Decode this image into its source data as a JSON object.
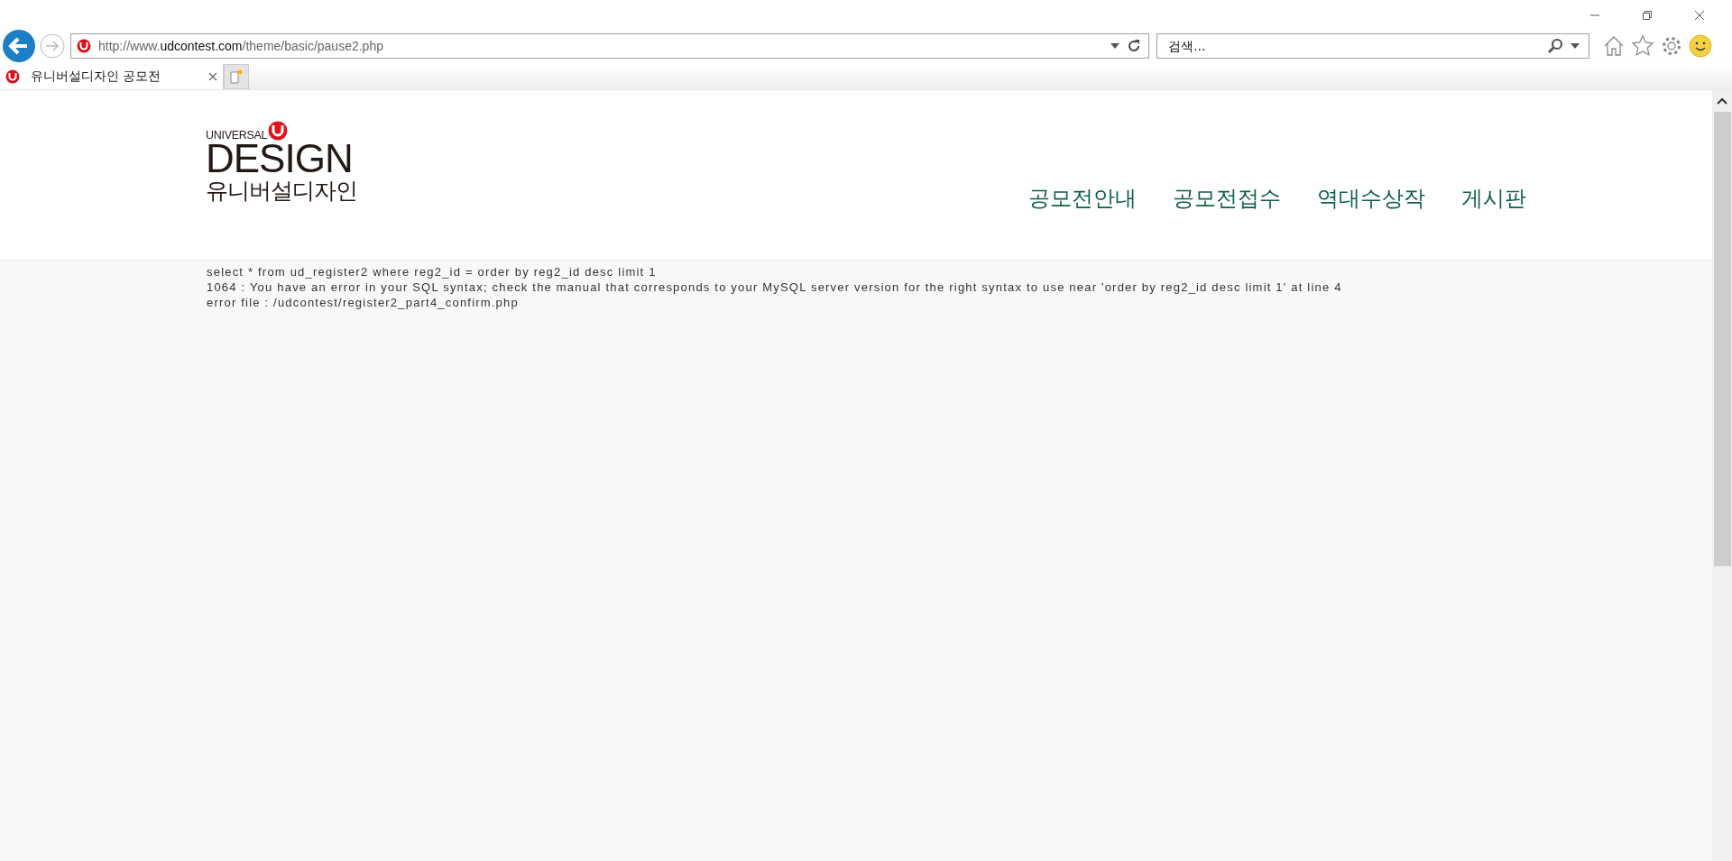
{
  "browser": {
    "address": {
      "prefix": "http://www.",
      "domain": "udcontest.com",
      "path": "/theme/basic/pause2.php"
    },
    "search": {
      "placeholder": "검색..."
    },
    "tabs": [
      {
        "title": "유니버설디자인 공모전",
        "selected": true
      }
    ]
  },
  "logo": {
    "top": "UNIVERSAL",
    "main": "DESIGN",
    "korean": "유니버설디자인"
  },
  "nav": [
    {
      "label": "공모전안내"
    },
    {
      "label": "공모전접수"
    },
    {
      "label": "역대수상작"
    },
    {
      "label": "게시판"
    }
  ],
  "error_lines": [
    "select * from ud_register2 where reg2_id = order by reg2_id desc limit 1",
    "1064 : You have an error in your SQL syntax; check the manual that corresponds to your MySQL server version for the right syntax to use near 'order by reg2_id desc limit 1' at line 4",
    "error file : /udcontest/register2_part4_confirm.php"
  ]
}
